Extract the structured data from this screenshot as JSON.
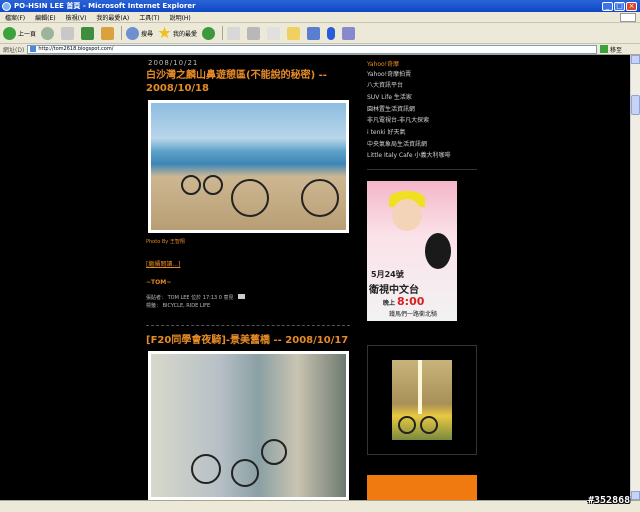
{
  "window": {
    "title": "PO-HSIN LEE 首頁 - Microsoft Internet Explorer",
    "controls": [
      "_",
      "□",
      "×"
    ]
  },
  "menu": [
    "檔案(F)",
    "編輯(E)",
    "檢視(V)",
    "我的最愛(A)",
    "工具(T)",
    "說明(H)"
  ],
  "toolbar": {
    "back_label": "上一頁",
    "search_label": "搜尋",
    "favorites_label": "我的最愛"
  },
  "address": {
    "label": "網址(D)",
    "url": "http://tom2618.blogspot.com/",
    "go_label": "移至"
  },
  "posts": [
    {
      "date": "2008/10/21",
      "title": "白沙灣之麟山鼻遊憩區(不能說的秘密) -- 2008/10/18",
      "credit": "Photo By 王智翔",
      "read_more": "[繼續閱讀...]",
      "signature": "~TOM~",
      "meta_line1": "張貼者： TOM LEE 位於 17:13 0 意見",
      "meta_line2": "標籤： BICYCLE, RIDE LIFE"
    },
    {
      "title": "[F20同學會夜騎]-景美舊橋 -- 2008/10/17"
    }
  ],
  "sidebar": {
    "links": [
      "Yahoo!奇摩",
      "Yahoo!奇摩拍賣",
      "八大資訊平台",
      "SUV Life 生活家",
      "園林置生活資訊網",
      "非凡電視台-非凡大探索",
      "i tenki 好天氣",
      "中央氣象局生活資訊網",
      "Little Italy Cafe 小義大利咖啡"
    ],
    "ad": {
      "date": "5月24號",
      "channel": "衛視中文台",
      "time_prefix": "晚上",
      "time": "8:00",
      "route": "鐵馬們一路衝北騎"
    }
  },
  "watermark": "#352868"
}
